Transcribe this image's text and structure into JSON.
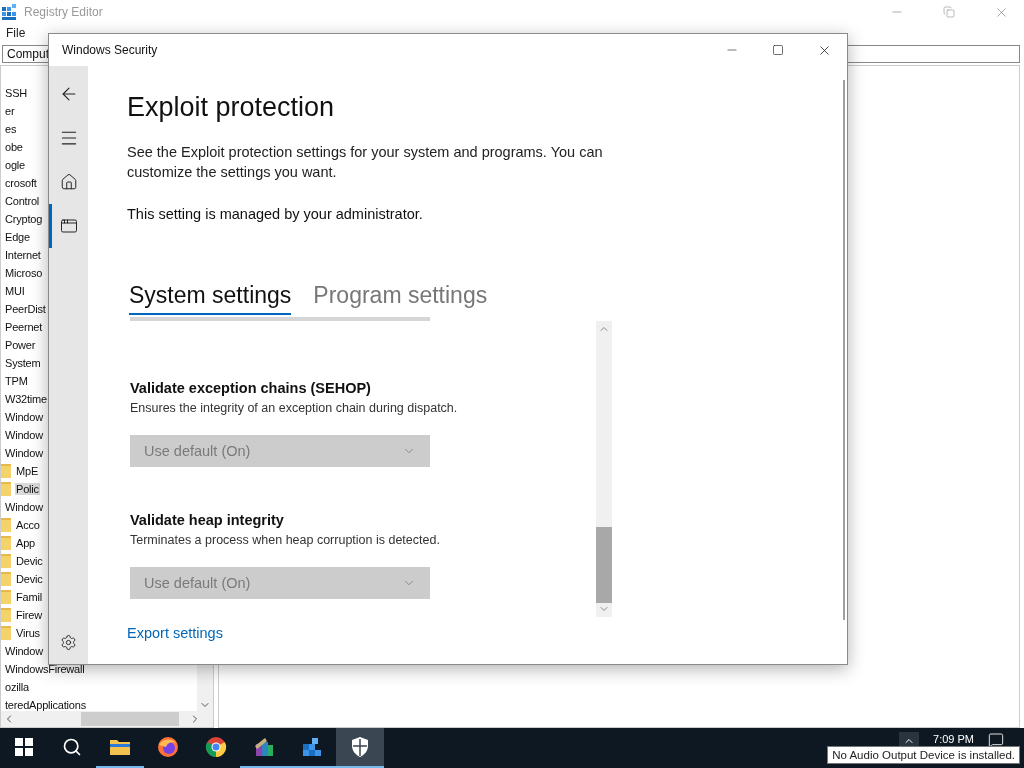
{
  "registry_editor": {
    "title": "Registry Editor",
    "menu": [
      "File"
    ],
    "address": "Comput",
    "tree": [
      {
        "label": "SSH",
        "selected": false
      },
      {
        "label": "er",
        "selected": false
      },
      {
        "label": "es",
        "selected": false
      },
      {
        "label": "obe",
        "selected": false
      },
      {
        "label": "ogle",
        "selected": false
      },
      {
        "label": "crosoft",
        "selected": false
      },
      {
        "label": "Control",
        "selected": false
      },
      {
        "label": "Cryptog",
        "selected": false
      },
      {
        "label": "Edge",
        "selected": false
      },
      {
        "label": "Internet",
        "selected": false
      },
      {
        "label": "Microso",
        "selected": false
      },
      {
        "label": "MUI",
        "selected": false
      },
      {
        "label": "PeerDist",
        "selected": false
      },
      {
        "label": "Peernet",
        "selected": false
      },
      {
        "label": "Power",
        "selected": false
      },
      {
        "label": "System",
        "selected": false
      },
      {
        "label": "TPM",
        "selected": false
      },
      {
        "label": "W32time",
        "selected": false
      },
      {
        "label": "Window",
        "selected": false
      },
      {
        "label": "Window",
        "selected": false
      },
      {
        "label": "Window",
        "selected": false,
        "children": [
          {
            "label": "MpE",
            "selected": false
          },
          {
            "label": "Polic",
            "selected": true
          }
        ]
      },
      {
        "label": "Window",
        "selected": false,
        "children": [
          {
            "label": "Acco",
            "selected": false
          },
          {
            "label": "App",
            "selected": false
          },
          {
            "label": "Devic",
            "selected": false
          },
          {
            "label": "Devic",
            "selected": false
          },
          {
            "label": "Famil",
            "selected": false
          },
          {
            "label": "Firew",
            "selected": false
          },
          {
            "label": "Virus",
            "selected": false
          }
        ]
      },
      {
        "label": "Window",
        "selected": false
      },
      {
        "label": "WindowsFirewall",
        "selected": false
      },
      {
        "label": "ozilla",
        "selected": false
      },
      {
        "label": "teredApplications",
        "selected": false
      }
    ]
  },
  "security_window": {
    "title": "Windows Security",
    "nav": [
      {
        "kind": "back",
        "selected": false
      },
      {
        "kind": "menu",
        "selected": false
      },
      {
        "kind": "home",
        "selected": false
      },
      {
        "kind": "app",
        "selected": true
      }
    ],
    "heading": "Exploit protection",
    "description": "See the Exploit protection settings for your system and programs.  You can customize the settings you want.",
    "notice": "This setting is managed by your administrator.",
    "tabs": [
      {
        "label": "System settings",
        "selected": true
      },
      {
        "label": "Program settings",
        "selected": false
      }
    ],
    "settings": [
      {
        "title": "Validate exception chains (SEHOP)",
        "description": "Ensures the integrity of an exception chain during dispatch.",
        "dropdown": {
          "value": "Use default (On)",
          "disabled": true
        }
      },
      {
        "title": "Validate heap integrity",
        "description": "Terminates a process when heap corruption is detected.",
        "dropdown": {
          "value": "Use default (On)",
          "disabled": true
        }
      }
    ],
    "export_link": "Export settings"
  },
  "taskbar": {
    "apps": [
      {
        "kind": "search",
        "running": false,
        "selected": false
      },
      {
        "kind": "explorer",
        "running": true,
        "selected": false
      },
      {
        "kind": "firefox",
        "running": false,
        "selected": false
      },
      {
        "kind": "chrome",
        "running": false,
        "selected": false
      },
      {
        "kind": "archiver",
        "running": true,
        "selected": false
      },
      {
        "kind": "regedit",
        "running": true,
        "selected": false
      },
      {
        "kind": "security",
        "running": true,
        "selected": true
      }
    ],
    "clock": "7:09 PM",
    "tooltip": "No Audio Output Device is installed."
  }
}
